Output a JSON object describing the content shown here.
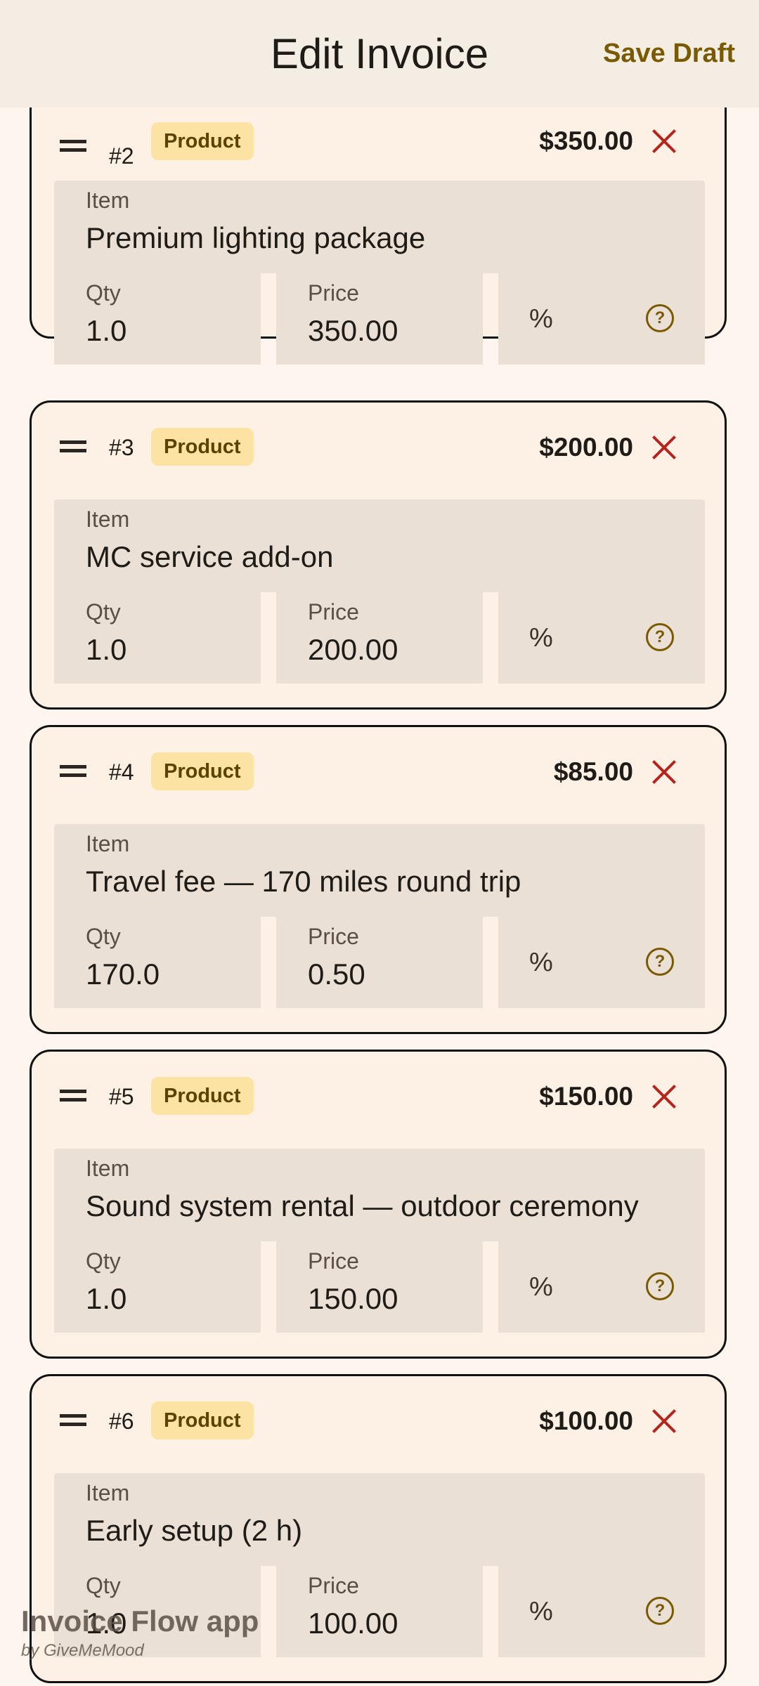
{
  "header": {
    "title": "Edit Invoice",
    "save_label": "Save Draft"
  },
  "fields": {
    "item_label": "Item",
    "qty_label": "Qty",
    "price_label": "Price",
    "discount_symbol": "%"
  },
  "items": [
    {
      "number": "#2",
      "type": "Product",
      "amount": "$350.00",
      "item": "Premium lighting package",
      "qty": "1.0",
      "price": "350.00"
    },
    {
      "number": "#3",
      "type": "Product",
      "amount": "$200.00",
      "item": "MC service add-on",
      "qty": "1.0",
      "price": "200.00"
    },
    {
      "number": "#4",
      "type": "Product",
      "amount": "$85.00",
      "item": "Travel fee — 170 miles round trip",
      "qty": "170.0",
      "price": "0.50"
    },
    {
      "number": "#5",
      "type": "Product",
      "amount": "$150.00",
      "item": "Sound system rental — outdoor ceremony",
      "qty": "1.0",
      "price": "150.00"
    },
    {
      "number": "#6",
      "type": "Product",
      "amount": "$100.00",
      "item": "Early setup (2 h)",
      "qty": "1.0",
      "price": "100.00"
    }
  ],
  "watermark": {
    "title": "Invoice Flow app",
    "subtitle": "by GiveMeMood"
  },
  "colors": {
    "accent": "#7a5a00",
    "delete": "#b3261e",
    "badge_bg": "#fde3a3",
    "field_bg": "#ebe0d5",
    "card_bg": "#fdf1e6"
  }
}
